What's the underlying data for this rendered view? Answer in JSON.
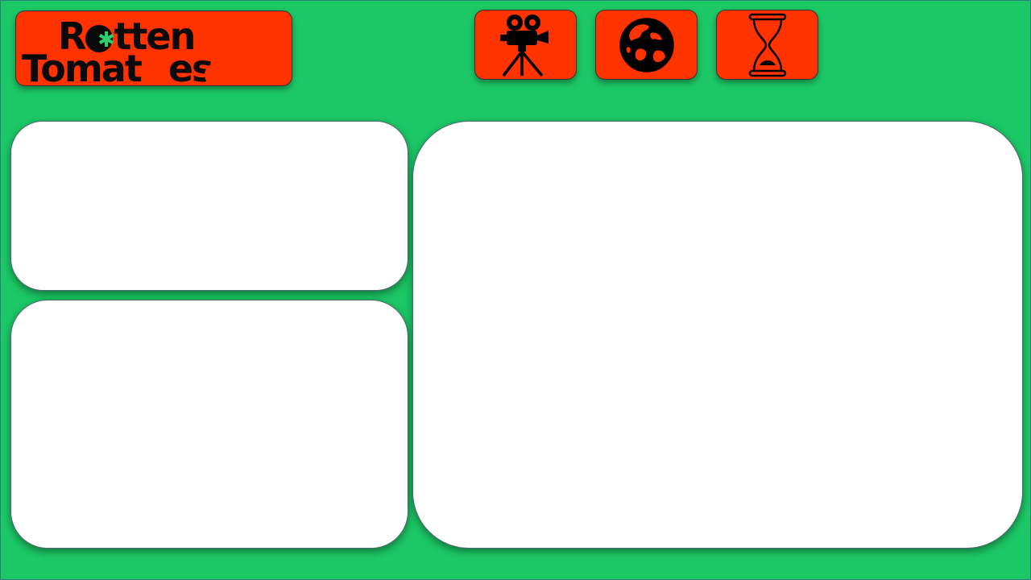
{
  "logo": {
    "line1_pre": "R",
    "line1_post": "tten",
    "line2_pre": "Tomat",
    "line2_post": "es",
    "brand_color": "#ff3300",
    "background_color": "#1cc866"
  },
  "nav_buttons": [
    {
      "icon": "film-camera-icon"
    },
    {
      "icon": "globe-icon"
    },
    {
      "icon": "hourglass-icon"
    }
  ],
  "panels": [
    {
      "name": "content-panel-top-left"
    },
    {
      "name": "content-panel-bottom-left"
    },
    {
      "name": "content-panel-main"
    }
  ]
}
